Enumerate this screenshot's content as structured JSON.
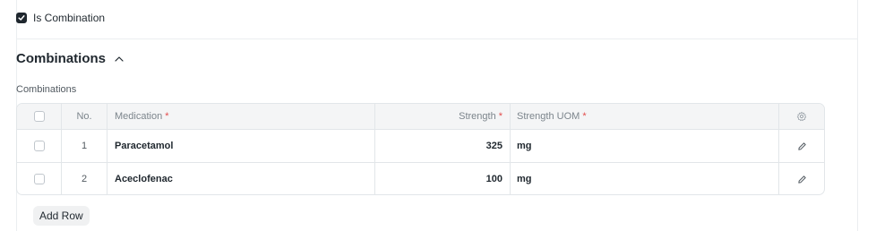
{
  "is_combination": {
    "label": "Is Combination",
    "checked": true
  },
  "section": {
    "title": "Combinations",
    "collapse_icon": "chevron-up-icon"
  },
  "field": {
    "label": "Combinations"
  },
  "table": {
    "columns": {
      "no": "No.",
      "medication": "Medication",
      "strength": "Strength",
      "strength_uom": "Strength UOM",
      "required_marker": "*"
    },
    "settings_icon": "gear-icon",
    "edit_icon": "pencil-icon",
    "rows": [
      {
        "no": "1",
        "medication": "Paracetamol",
        "strength": "325",
        "uom": "mg"
      },
      {
        "no": "2",
        "medication": "Aceclofenac",
        "strength": "100",
        "uom": "mg"
      }
    ]
  },
  "add_row_label": "Add Row",
  "colors": {
    "text": "#1f272e",
    "muted": "#7c858c",
    "required": "#e24c4c",
    "border": "#e2e6e9"
  }
}
